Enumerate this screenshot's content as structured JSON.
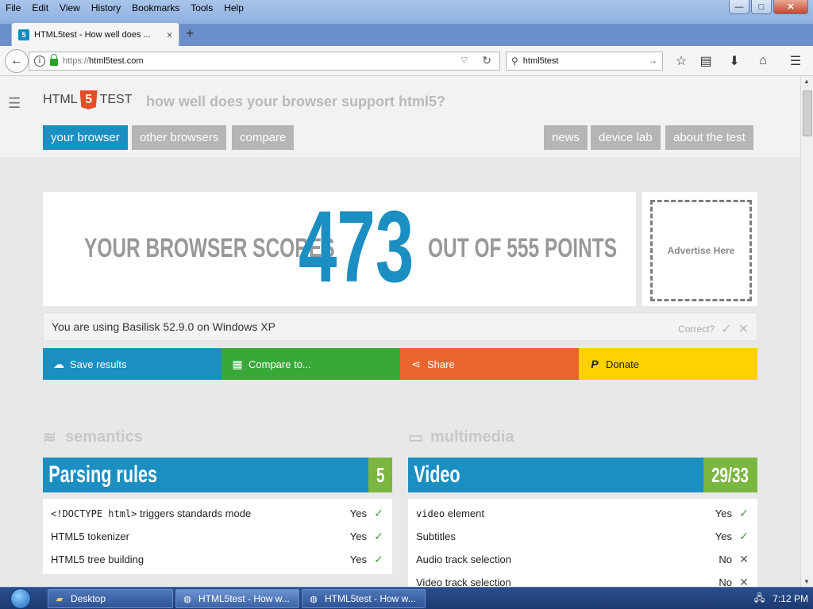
{
  "menu": [
    "File",
    "Edit",
    "View",
    "History",
    "Bookmarks",
    "Tools",
    "Help"
  ],
  "window_controls": {
    "minimize": "—",
    "maximize": "□",
    "close": "✕"
  },
  "tab": {
    "title": "HTML5test - How well does ...",
    "close": "×",
    "new_tab": "+"
  },
  "urlbar": {
    "scheme": "https://",
    "host": "html5test.com"
  },
  "search": {
    "value": "html5test"
  },
  "site": {
    "logo_left": "HTML",
    "logo_five": "5",
    "logo_right": "TEST",
    "tagline": "how well does your browser support html5?",
    "nav_left": [
      "your browser",
      "other browsers",
      "compare"
    ],
    "nav_right": [
      "news",
      "device lab",
      "about the test"
    ]
  },
  "score": {
    "prefix": "YOUR BROWSER SCORES",
    "value": "473",
    "suffix": "OUT OF 555 POINTS"
  },
  "ad": {
    "label": "Advertise Here"
  },
  "ua": {
    "text": "You are using Basilisk 52.9.0 on Windows XP",
    "correct": "Correct?"
  },
  "actions": {
    "save": "Save results",
    "compare": "Compare to...",
    "share": "Share",
    "donate": "Donate"
  },
  "colors": {
    "blue": "#1b8ec2",
    "green": "#38a838",
    "orange": "#ea6430",
    "yellow": "#ffd100",
    "score_green": "#7ab640"
  },
  "sections": {
    "semantics": {
      "title": "semantics",
      "card_title": "Parsing rules",
      "card_score": "5",
      "rows": [
        {
          "label_code": "<!DOCTYPE html>",
          "label": " triggers standards mode",
          "result": "Yes"
        },
        {
          "label_code": "",
          "label": "HTML5 tokenizer",
          "result": "Yes"
        },
        {
          "label_code": "",
          "label": "HTML5 tree building",
          "result": "Yes"
        }
      ]
    },
    "multimedia": {
      "title": "multimedia",
      "card_title": "Video",
      "card_score": "29/33",
      "rows": [
        {
          "label_code": "video",
          "label": " element",
          "result": "Yes"
        },
        {
          "label_code": "",
          "label": "Subtitles",
          "result": "Yes"
        },
        {
          "label_code": "",
          "label": "Audio track selection",
          "result": "No"
        },
        {
          "label_code": "",
          "label": "Video track selection",
          "result": "No"
        }
      ]
    }
  },
  "taskbar": {
    "tasks": [
      "Desktop",
      "HTML5test - How w...",
      "HTML5test - How w..."
    ],
    "clock": "7:12 PM"
  }
}
